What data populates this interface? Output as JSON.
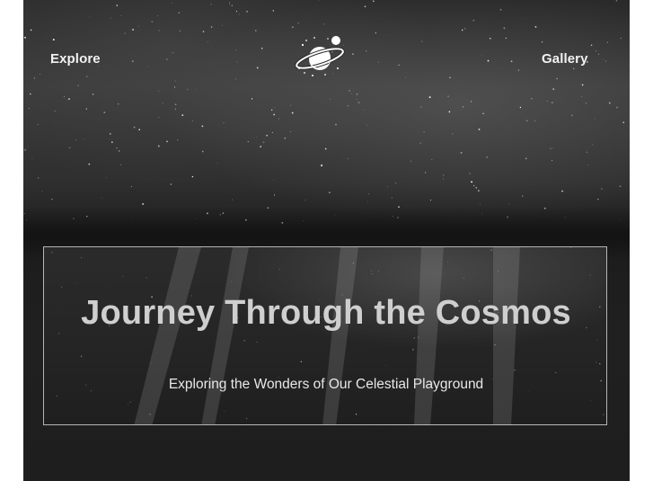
{
  "nav": {
    "left_link": "Explore",
    "right_link": "Gallery",
    "logo_icon": "planet-logo-icon"
  },
  "hero": {
    "title": "Journey Through the Cosmos",
    "subtitle": "Exploring the Wonders of Our Celestial Playground"
  },
  "colors": {
    "background": "#1e1e1e",
    "text_primary": "#f2f2f2",
    "title_text": "#cfcfcf",
    "border": "#e6e6e6"
  }
}
